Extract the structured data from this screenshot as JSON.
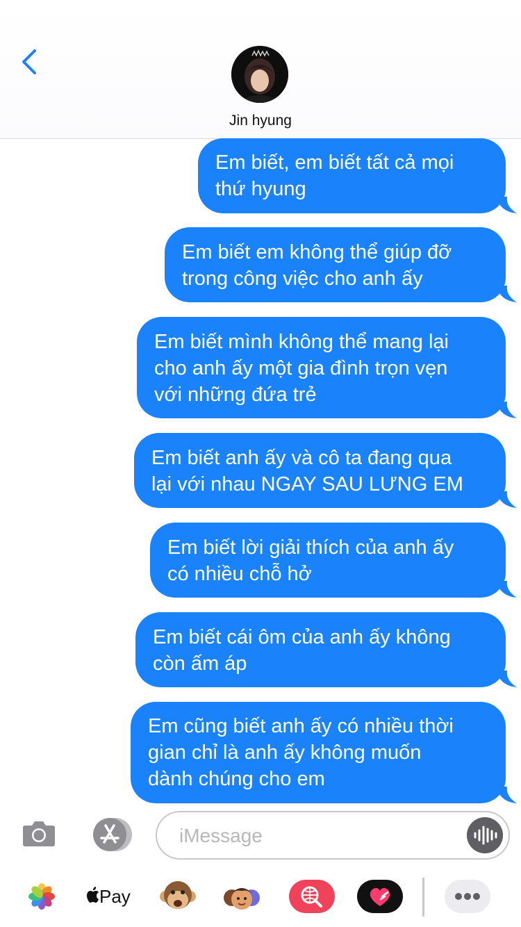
{
  "status": {
    "battery_color": "#4cd964"
  },
  "header": {
    "back_icon": "chevron-left-icon",
    "contact_name": "Jin hyung",
    "accent_color": "#1a82fb"
  },
  "messages": [
    {
      "text": "Em biết, em biết tất cả mọi\nthứ hyung",
      "sender": "me"
    },
    {
      "text": "Em biết em không thể giúp đỡ\ntrong công việc cho anh ấy",
      "sender": "me"
    },
    {
      "text": "Em biết mình không thể mang lại\ncho anh ấy một gia đình trọn vẹn\nvới những đứa trẻ",
      "sender": "me"
    },
    {
      "text": "Em biết anh ấy và cô ta đang qua\nlại với nhau NGAY SAU LƯNG EM",
      "sender": "me"
    },
    {
      "text": "Em biết lời giải thích của anh ấy\ncó nhiều chỗ hở",
      "sender": "me"
    },
    {
      "text": "Em biết cái ôm của anh ấy không\ncòn ấm áp",
      "sender": "me"
    },
    {
      "text": "Em cũng biết anh ấy có nhiều thời\ngian chỉ là anh ấy không muốn\ndành chúng cho em",
      "sender": "me"
    }
  ],
  "composer": {
    "placeholder": "iMessage",
    "camera_icon": "camera-icon",
    "apps_icon": "app-store-icon",
    "audio_icon": "audio-waveform-icon"
  },
  "tray": {
    "items": [
      {
        "icon": "photos-icon"
      },
      {
        "icon": "apple-pay-icon",
        "label": "Pay"
      },
      {
        "icon": "monkey-animoji-icon"
      },
      {
        "icon": "memoji-stickers-icon"
      },
      {
        "icon": "web-image-search-icon"
      },
      {
        "icon": "digital-touch-heart-icon"
      },
      {
        "icon": "more-icon"
      }
    ]
  }
}
